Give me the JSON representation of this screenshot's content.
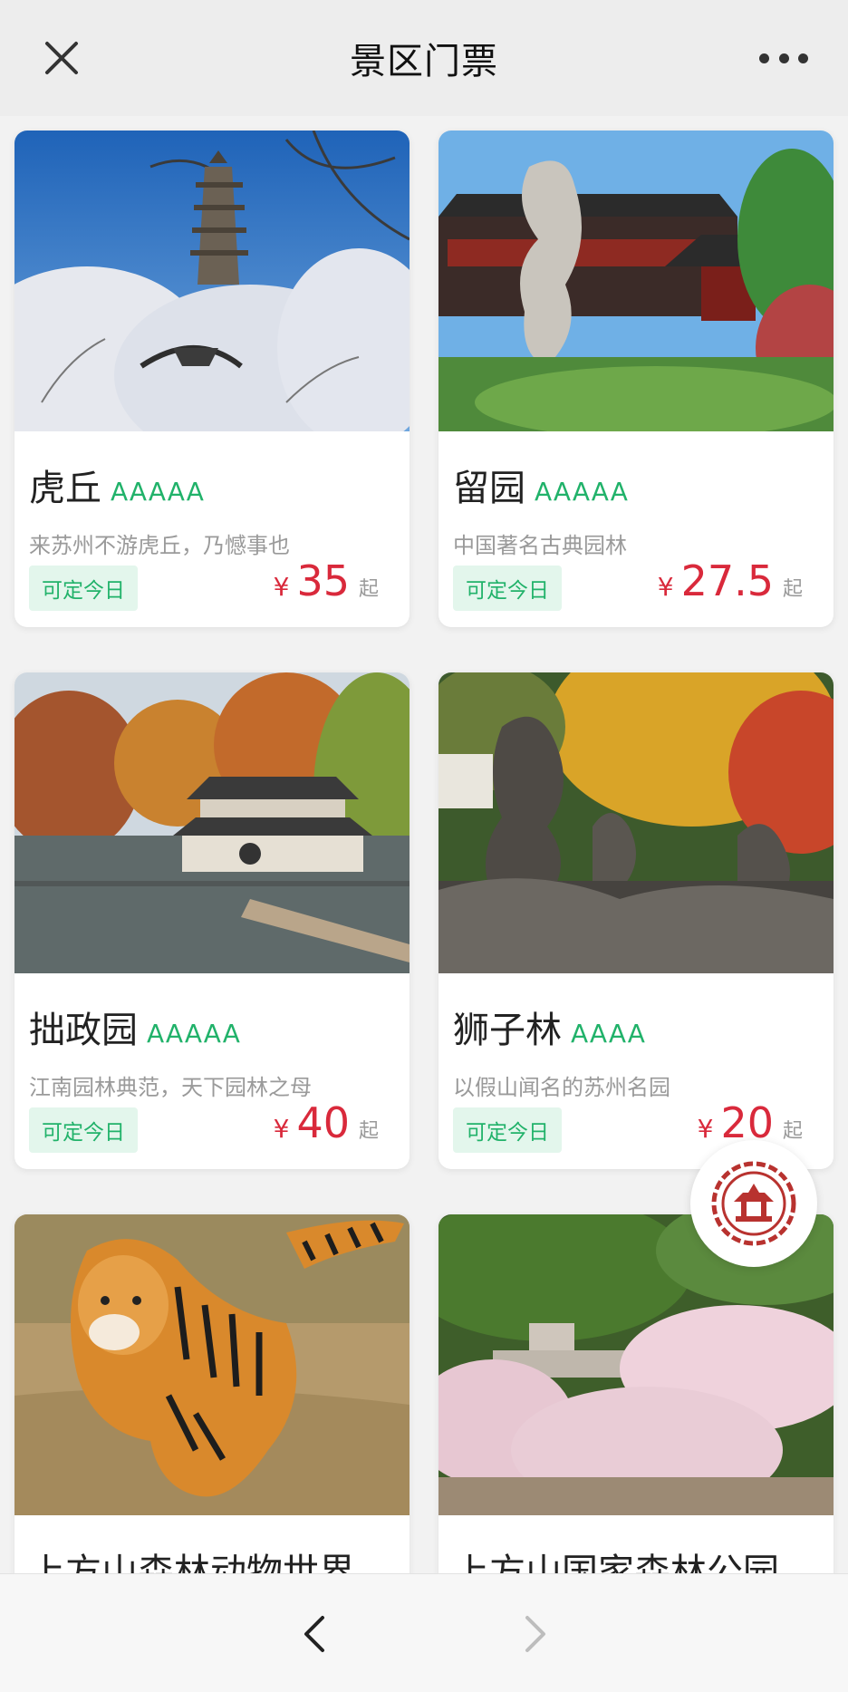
{
  "header": {
    "title": "景区门票",
    "close_icon": "close-icon",
    "more_icon": "more-icon"
  },
  "cards": [
    {
      "name": "虎丘",
      "grade": "AAAAA",
      "desc": "来苏州不游虎丘，乃憾事也",
      "tag": "可定今日",
      "currency": "¥",
      "price": "35",
      "suffix": "起",
      "photo": "pagoda-photo"
    },
    {
      "name": "留园",
      "grade": "AAAAA",
      "desc": "中国著名古典园林",
      "tag": "可定今日",
      "currency": "¥",
      "price": "27.5",
      "suffix": "起",
      "photo": "garden-rock-photo"
    },
    {
      "name": "拙政园",
      "grade": "AAAAA",
      "desc": "江南园林典范，天下园林之母",
      "tag": "可定今日",
      "currency": "¥",
      "price": "40",
      "suffix": "起",
      "photo": "pavilion-lake-photo"
    },
    {
      "name": "狮子林",
      "grade": "AAAA",
      "desc": "以假山闻名的苏州名园",
      "tag": "可定今日",
      "currency": "¥",
      "price": "20",
      "suffix": "起",
      "photo": "rockery-photo"
    },
    {
      "name": "上方山森林动物世界",
      "photo": "tiger-photo"
    },
    {
      "name": "上方山国家森林公园",
      "photo": "blossom-park-photo"
    }
  ],
  "colors": {
    "accent_green": "#21b26a",
    "price_red": "#d9293b",
    "logo_red": "#b8322f"
  },
  "float_button_icon": "pavilion-logo-icon",
  "bottom": {
    "back_icon": "chevron-left-icon",
    "forward_icon": "chevron-right-icon"
  }
}
